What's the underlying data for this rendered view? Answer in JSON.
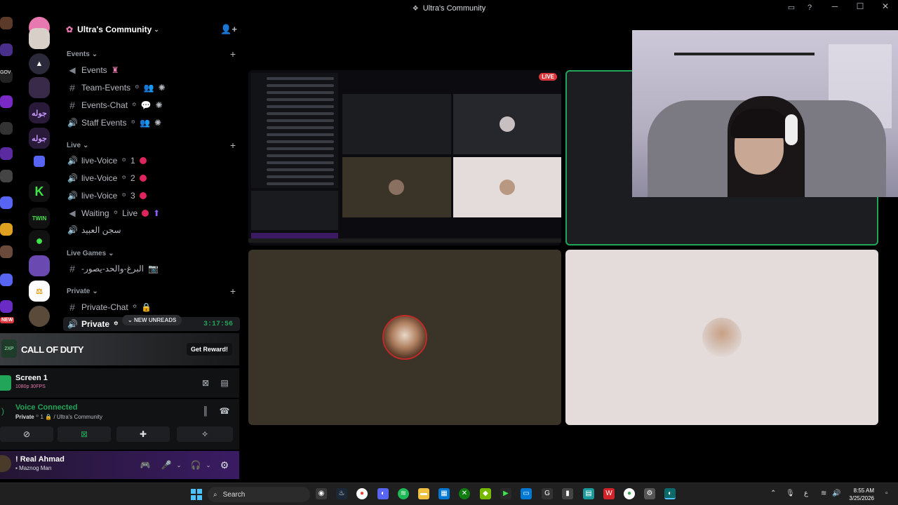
{
  "window": {
    "title": "Ultra's Community"
  },
  "rail": {
    "labels": [
      "جوله",
      "جوله",
      "TWIN"
    ],
    "new_label": "NEW",
    "gov_label": "GOV"
  },
  "sidebar": {
    "guild_name": "Ultra's Community",
    "categories": [
      {
        "label": "Events"
      },
      {
        "label": "Live"
      },
      {
        "label": "Live Games"
      },
      {
        "label": "Private"
      }
    ],
    "channels": {
      "events": "Events",
      "team_events": "Team-Events",
      "events_chat": "Events-Chat",
      "staff_events": "Staff Events",
      "live1": "live-Voice",
      "live2": "live-Voice",
      "live3": "live-Voice",
      "waiting": "Waiting",
      "waiting_live": "Live",
      "arabic": "سجن العبيد",
      "live_games": "-البرغ-والحد-يصور",
      "private_chat": "Private-Chat",
      "private_voice": "Private"
    },
    "channel_suffix": {
      "sep": "꙳",
      "n1": "1",
      "n2": "2",
      "n3": "3"
    },
    "timer": "3:17:56",
    "new_unreads": "NEW UNREADS"
  },
  "promo": {
    "brand": "CALL OF DUTY",
    "cta": "Get Reward!",
    "logo_text": "2XP"
  },
  "stream": {
    "name": "Screen 1",
    "quality": "1080p 30FPS"
  },
  "voice": {
    "status": "Voice Connected",
    "channel": "Private",
    "channel_num": "1",
    "server": "/ Ultra's Community"
  },
  "user": {
    "name": "! Real Ahmad",
    "status": "Maznog Man"
  },
  "stage": {
    "live_badge": "LIVE"
  },
  "taskbar": {
    "search_placeholder": "Search",
    "time": "8:55 AM",
    "date": "3/25/2026",
    "lang": "ع"
  },
  "colors": {
    "accent_green": "#23a559",
    "live_red": "#da373c",
    "badge_pink": "#e0245e",
    "brand_pink": "#e879b0"
  }
}
